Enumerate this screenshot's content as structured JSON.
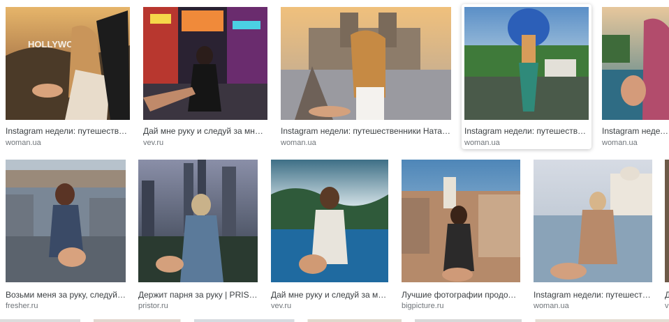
{
  "results": [
    {
      "caption": "Instagram недели: путешественники...",
      "domain": "woman.ua",
      "thumb_icon": "hollywood-photo-image"
    },
    {
      "caption": "Дай мне руку и следуй за мной...",
      "domain": "vev.ru",
      "thumb_icon": "neon-street-photo-image"
    },
    {
      "caption": "Instagram недели: путешественники Натальи...",
      "domain": "woman.ua",
      "thumb_icon": "cathedral-photo-image"
    },
    {
      "caption": "Instagram недели: путешественники...",
      "domain": "woman.ua",
      "thumb_icon": "feather-headdress-photo-image"
    },
    {
      "caption": "Instagram недели:",
      "domain": "woman.ua",
      "thumb_icon": "lake-photo-image"
    },
    {
      "caption": "Возьми меня за руку, следуй ...",
      "domain": "fresher.ru",
      "thumb_icon": "memorial-blocks-photo-image"
    },
    {
      "caption": "Держит парня за руку | PRIST...",
      "domain": "pristor.ru",
      "thumb_icon": "skyscrapers-photo-image"
    },
    {
      "caption": "Дай мне руку и следуй за мн...",
      "domain": "vev.ru",
      "thumb_icon": "infinity-pool-photo-image"
    },
    {
      "caption": "Лучшие фотографии продолж...",
      "domain": "bigpicture.ru",
      "thumb_icon": "rooftop-town-photo-image"
    },
    {
      "caption": "Instagram недели: путешеств...",
      "domain": "woman.ua",
      "thumb_icon": "palace-lake-photo-image"
    },
    {
      "caption": "Д",
      "domain": "v",
      "thumb_icon": "partial-photo-image"
    }
  ]
}
